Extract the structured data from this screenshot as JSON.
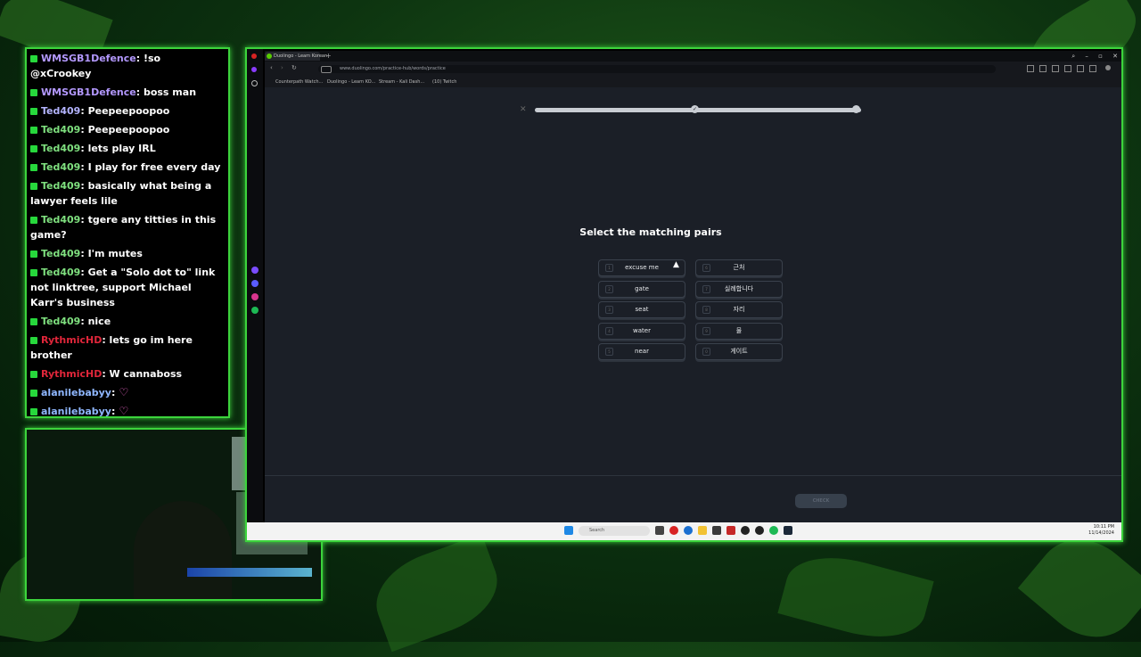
{
  "chat": {
    "messages": [
      {
        "user": "WMSGB1Defence",
        "text": ": !so @xCrookey",
        "user_color": "#b499ff"
      },
      {
        "user": "WMSGB1Defence",
        "text": ": boss man",
        "user_color": "#b499ff"
      },
      {
        "user": "Ted409",
        "text": ": Peepeepoopoo",
        "user_color": "#b4b4ff"
      },
      {
        "user": "Ted409",
        "text": ": Peepeepoopoo",
        "user_color": "#7fe07f"
      },
      {
        "user": "Ted409",
        "text": ": lets play IRL",
        "user_color": "#7fe07f"
      },
      {
        "user": "Ted409",
        "text": ": I play for free every day",
        "user_color": "#7fe07f"
      },
      {
        "user": "Ted409",
        "text": ": basically what being a lawyer feels lile",
        "user_color": "#7fe07f"
      },
      {
        "user": "Ted409",
        "text": ": tgere any titties in this game?",
        "user_color": "#7fe07f"
      },
      {
        "user": "Ted409",
        "text": ": I'm mutes",
        "user_color": "#7fe07f"
      },
      {
        "user": "Ted409",
        "text": ": Get a \"Solo dot to\" link not linktree, support Michael Karr's business",
        "user_color": "#7fe07f"
      },
      {
        "user": "Ted409",
        "text": ": nice",
        "user_color": "#7fe07f"
      },
      {
        "user": "RythmicHD",
        "text": ": lets go im here brother",
        "user_color": "#e0263a"
      },
      {
        "user": "RythmicHD",
        "text": ": W cannaboss",
        "user_color": "#e0263a"
      },
      {
        "user": "alanilebabyy",
        "text": ":",
        "user_color": "#8fb7ff"
      },
      {
        "user": "alanilebabyy",
        "text": ":",
        "user_color": "#8fb7ff"
      },
      {
        "user": "alanilebabyy",
        "text": ":",
        "user_color": "#8fb7ff"
      },
      {
        "user": "alanilebabyy",
        "text": ":",
        "user_color": "#8fb7ff"
      },
      {
        "user": "alanilebabyy",
        "text": ":",
        "user_color": "#8fb7ff"
      }
    ]
  },
  "browser": {
    "tab_title": "Duolingo - Learn Korean",
    "url": "www.duolingo.com/practice-hub/words/practice",
    "bookmarks": [
      "Counterpath Watch...",
      "Duolingo - Learn KO...",
      "Stream - Kali Dash...",
      "(10) Twitch"
    ]
  },
  "lesson": {
    "prompt": "Select the matching pairs",
    "progress": 1.0,
    "left": [
      {
        "num": "1",
        "label": "excuse me"
      },
      {
        "num": "2",
        "label": "gate"
      },
      {
        "num": "3",
        "label": "seat"
      },
      {
        "num": "4",
        "label": "water"
      },
      {
        "num": "5",
        "label": "near"
      }
    ],
    "right": [
      {
        "num": "6",
        "label": "근처"
      },
      {
        "num": "7",
        "label": "실례합니다"
      },
      {
        "num": "8",
        "label": "자리"
      },
      {
        "num": "9",
        "label": "물"
      },
      {
        "num": "0",
        "label": "게이트"
      }
    ],
    "check_label": "CHECK"
  },
  "taskbar": {
    "search_placeholder": "Search",
    "time": "10:11 PM",
    "date": "11/14/2024"
  },
  "colors": {
    "accent": "#3cd43c",
    "page_bg": "#1b1f27"
  }
}
